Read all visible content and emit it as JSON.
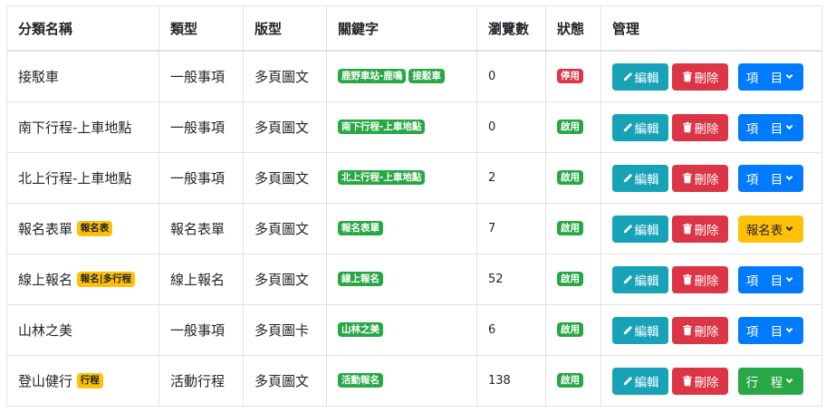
{
  "table": {
    "headers": [
      "分類名稱",
      "類型",
      "版型",
      "關鍵字",
      "瀏覽數",
      "狀態",
      "管理"
    ],
    "edit_label": "編輯",
    "delete_label": "刪除",
    "rows": [
      {
        "name": "接駁車",
        "name_badge": "",
        "type": "一般事項",
        "template": "多頁圖文",
        "keywords": [
          "鹿野車站-鹿鳴",
          "接駁車"
        ],
        "views": "0",
        "status": "停用",
        "status_color": "red",
        "item_label": "項　目",
        "item_color": "blue"
      },
      {
        "name": "南下行程-上車地點",
        "name_badge": "",
        "type": "一般事項",
        "template": "多頁圖文",
        "keywords": [
          "南下行程-上車地點"
        ],
        "views": "0",
        "status": "啟用",
        "status_color": "green",
        "item_label": "項　目",
        "item_color": "blue"
      },
      {
        "name": "北上行程-上車地點",
        "name_badge": "",
        "type": "一般事項",
        "template": "多頁圖文",
        "keywords": [
          "北上行程-上車地點"
        ],
        "views": "2",
        "status": "啟用",
        "status_color": "green",
        "item_label": "項　目",
        "item_color": "blue"
      },
      {
        "name": "報名表單",
        "name_badge": "報名表",
        "type": "報名表單",
        "template": "多頁圖文",
        "keywords": [
          "報名表單"
        ],
        "views": "7",
        "status": "啟用",
        "status_color": "green",
        "item_label": "報名表",
        "item_color": "yellow"
      },
      {
        "name": "線上報名",
        "name_badge": "報名|多行程",
        "type": "線上報名",
        "template": "多頁圖文",
        "keywords": [
          "線上報名"
        ],
        "views": "52",
        "status": "啟用",
        "status_color": "green",
        "item_label": "項　目",
        "item_color": "blue"
      },
      {
        "name": "山林之美",
        "name_badge": "",
        "type": "一般事項",
        "template": "多頁圖卡",
        "keywords": [
          "山林之美"
        ],
        "views": "6",
        "status": "啟用",
        "status_color": "green",
        "item_label": "項　目",
        "item_color": "blue"
      },
      {
        "name": "登山健行",
        "name_badge": "行程",
        "type": "活動行程",
        "template": "多頁圖文",
        "keywords": [
          "活動報名"
        ],
        "views": "138",
        "status": "啟用",
        "status_color": "green",
        "item_label": "行　程",
        "item_color": "green"
      }
    ]
  },
  "colors": {
    "info": "#17a2b8",
    "danger": "#dc3545",
    "primary": "#007bff",
    "warning": "#ffc107",
    "success": "#28a745"
  },
  "icons": {
    "edit": "pencil-icon",
    "delete": "trash-icon",
    "dropdown": "chevron-down-icon"
  }
}
